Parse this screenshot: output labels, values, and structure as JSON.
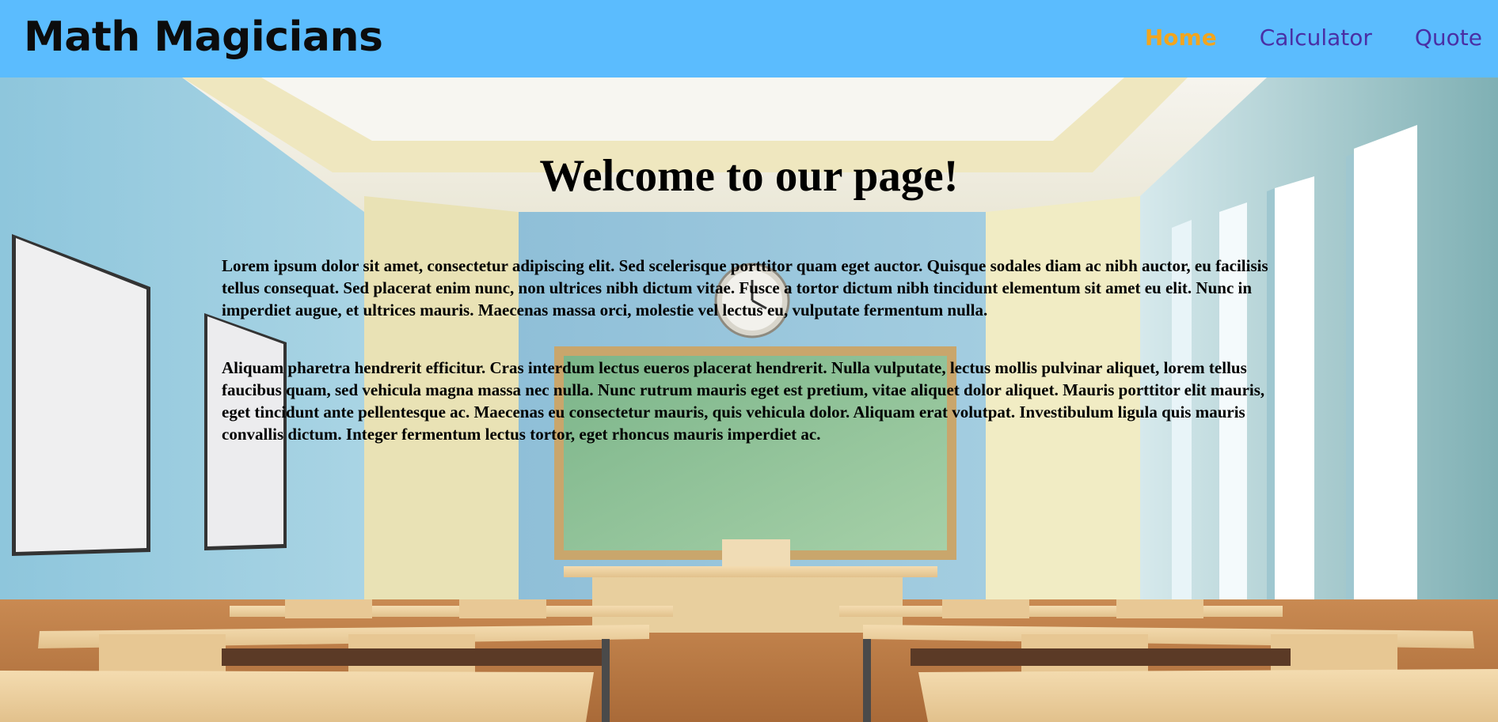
{
  "header": {
    "brand": "Math Magicians",
    "nav": [
      {
        "label": "Home",
        "active": true
      },
      {
        "label": "Calculator",
        "active": false
      },
      {
        "label": "Quote",
        "active": false
      }
    ]
  },
  "main": {
    "heading": "Welcome to our page!",
    "paragraphs": [
      "Lorem ipsum dolor sit amet, consectetur adipiscing elit. Sed scelerisque porttitor quam eget auctor. Quisque sodales diam ac nibh auctor, eu facilisis tellus consequat. Sed placerat enim nunc, non ultrices nibh dictum vitae. Fusce a tortor dictum nibh tincidunt elementum sit amet eu elit. Nunc in imperdiet augue, et ultrices mauris. Maecenas massa orci, molestie vel lectus eu, vulputate fermentum nulla.",
      "Aliquam pharetra hendrerit efficitur. Cras interdum lectus eueros placerat hendrerit. Nulla vulputate, lectus mollis pulvinar aliquet, lorem tellus faucibus quam, sed vehicula magna massa nec nulla. Nunc rutrum mauris eget est pretium, vitae aliquet dolor aliquet. Mauris porttitor elit mauris, eget tincidunt ante pellentesque ac. Maecenas eu consectetur mauris, quis vehicula dolor. Aliquam erat volutpat. Investibulum ligula quis mauris convallis dictum. Integer fermentum lectus tortor, eget rhoncus mauris imperdiet ac."
    ]
  },
  "colors": {
    "header_bg": "#5bbcfe",
    "nav_link": "#4a2fa5",
    "nav_active": "#f2a51e"
  }
}
